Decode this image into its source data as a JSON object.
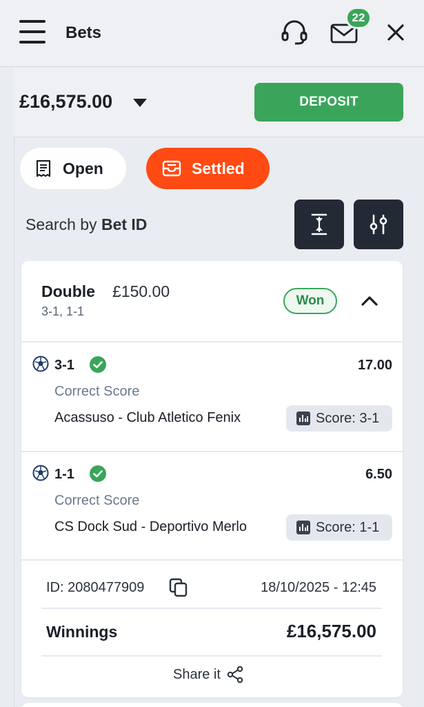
{
  "header": {
    "title": "Bets",
    "mail_count": "22"
  },
  "account": {
    "balance": "£16,575.00",
    "deposit_label": "DEPOSIT"
  },
  "tabs": [
    {
      "label": "Open",
      "active": false
    },
    {
      "label": "Settled",
      "active": true
    }
  ],
  "search": {
    "prefix": "Search by ",
    "bold": "Bet ID"
  },
  "bet": {
    "type": "Double",
    "stake": "£150.00",
    "scores": "3-1, 1-1",
    "status": "Won",
    "selections": [
      {
        "score": "3-1",
        "odds": "17.00",
        "market": "Correct Score",
        "event": "Acassuso - Club Atletico Fenix",
        "result": "Score: 3-1"
      },
      {
        "score": "1-1",
        "odds": "6.50",
        "market": "Correct Score",
        "event": "CS Dock Sud - Deportivo Merlo",
        "result": "Score: 1-1"
      }
    ],
    "id": "ID: 2080477909",
    "date": "18/10/2025 - 12:45",
    "winnings_label": "Winnings",
    "winnings_value": "£16,575.00",
    "share_label": "Share it"
  },
  "colors": {
    "accent_green": "#3aa55a",
    "accent_orange": "#ff4a14",
    "dark_button": "#232a36",
    "background": "#e9ecf0"
  },
  "icons": [
    "menu-icon",
    "headset-icon",
    "mail-icon",
    "close-icon",
    "caret-down-icon",
    "receipt-icon",
    "inbox-icon",
    "collapse-icon",
    "filter-icon",
    "chevron-up-icon",
    "football-icon",
    "check-circle-icon",
    "stats-icon",
    "copy-icon",
    "share-icon"
  ]
}
